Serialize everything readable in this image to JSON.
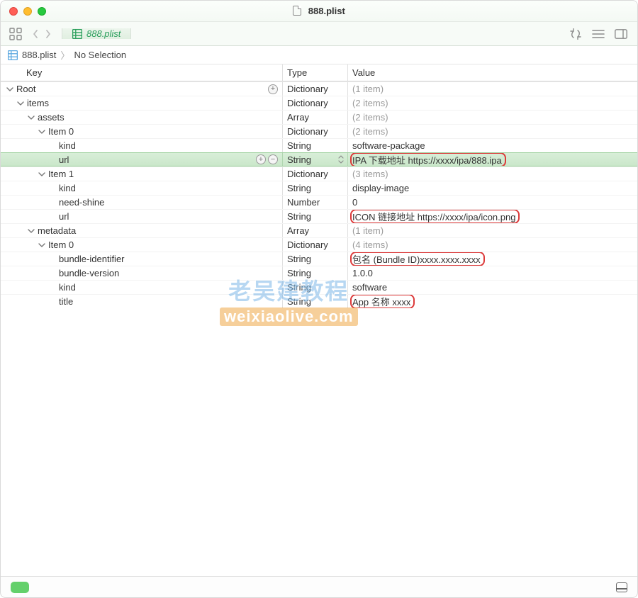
{
  "window": {
    "title": "888.plist"
  },
  "tab": {
    "label": "888.plist"
  },
  "breadcrumb": {
    "file": "888.plist",
    "selection": "No Selection"
  },
  "columns": {
    "key": "Key",
    "type": "Type",
    "value": "Value"
  },
  "types": {
    "dictionary": "Dictionary",
    "array": "Array",
    "string": "String",
    "number": "Number"
  },
  "rows": [
    {
      "indent": 0,
      "key": "Root",
      "open": true,
      "type": "dictionary",
      "value": "(1 item)",
      "dim": true,
      "root": true
    },
    {
      "indent": 1,
      "key": "items",
      "open": true,
      "type": "dictionary",
      "value": "(2 items)",
      "dim": true
    },
    {
      "indent": 2,
      "key": "assets",
      "open": true,
      "type": "array",
      "value": "(2 items)",
      "dim": true
    },
    {
      "indent": 3,
      "key": "Item 0",
      "open": true,
      "type": "dictionary",
      "value": "(2 items)",
      "dim": true
    },
    {
      "indent": 4,
      "key": "kind",
      "open": null,
      "type": "string",
      "value": "software-package"
    },
    {
      "indent": 4,
      "key": "url",
      "open": null,
      "type": "string",
      "value": "IPA 下载地址 https://xxxx/ipa/888.ipa",
      "selected": true,
      "highlight": true
    },
    {
      "indent": 3,
      "key": "Item 1",
      "open": true,
      "type": "dictionary",
      "value": "(3 items)",
      "dim": true
    },
    {
      "indent": 4,
      "key": "kind",
      "open": null,
      "type": "string",
      "value": "display-image"
    },
    {
      "indent": 4,
      "key": "need-shine",
      "open": null,
      "type": "number",
      "value": "0"
    },
    {
      "indent": 4,
      "key": "url",
      "open": null,
      "type": "string",
      "value": "ICON 链接地址 https://xxxx/ipa/icon.png",
      "highlight": true
    },
    {
      "indent": 2,
      "key": "metadata",
      "open": true,
      "type": "array",
      "value": "(1 item)",
      "dim": true
    },
    {
      "indent": 3,
      "key": "Item 0",
      "open": true,
      "type": "dictionary",
      "value": "(4 items)",
      "dim": true
    },
    {
      "indent": 4,
      "key": "bundle-identifier",
      "open": null,
      "type": "string",
      "value": "包名 (Bundle ID)xxxx.xxxx.xxxx",
      "highlight": true
    },
    {
      "indent": 4,
      "key": "bundle-version",
      "open": null,
      "type": "string",
      "value": "1.0.0"
    },
    {
      "indent": 4,
      "key": "kind",
      "open": null,
      "type": "string",
      "value": "software"
    },
    {
      "indent": 4,
      "key": "title",
      "open": null,
      "type": "string",
      "value": "App 名称 xxxx",
      "highlight": true
    }
  ],
  "watermark": {
    "line1": "老吴建教程",
    "line2": "weixiaolive.com"
  }
}
